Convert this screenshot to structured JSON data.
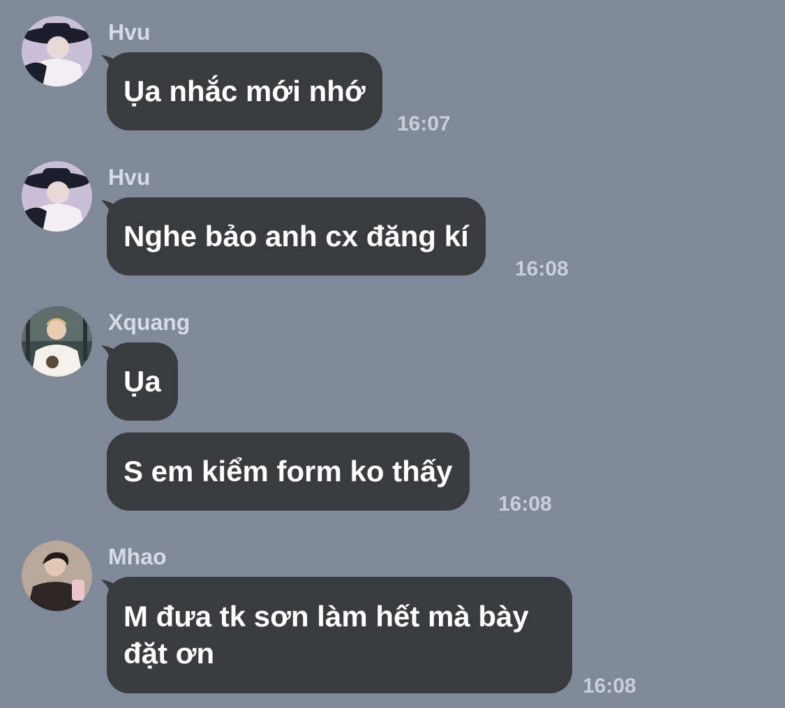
{
  "messages": [
    {
      "sender": "Hvu",
      "text": "Ụa nhắc mới nhớ",
      "time": "16:07"
    },
    {
      "sender": "Hvu",
      "text": "Nghe bảo anh cx đăng kí",
      "time": "16:08"
    },
    {
      "sender": "Xquang",
      "text": "Ụa"
    },
    {
      "text": "S em kiểm form ko thấy",
      "time": "16:08"
    },
    {
      "sender": "Mhao",
      "text": "M đưa tk sơn làm hết mà bày đặt ơn",
      "time": "16:08"
    }
  ],
  "colors": {
    "background": "#7f899a",
    "bubble": "#3a3b3f",
    "sender_text": "#d6dbe4",
    "time_text": "#c9ced8"
  }
}
